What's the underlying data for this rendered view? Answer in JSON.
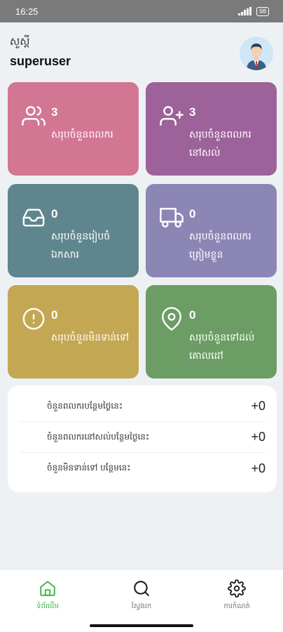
{
  "status_bar": {
    "time": "16:25",
    "battery": "98"
  },
  "header": {
    "greeting": "សួស្តី",
    "username": "superuser"
  },
  "cards": [
    {
      "id": "received",
      "count": "3",
      "label": "សរុបចំនួនពលករ",
      "color": "#d27693",
      "icon": "users-icon"
    },
    {
      "id": "remaining",
      "count": "3",
      "label": "សរុបចំនួនពលករ នៅសល់",
      "color": "#9d6299",
      "icon": "user-plus-icon"
    },
    {
      "id": "documents",
      "count": "0",
      "label": "សរុបចំនួនរៀបចំ ឯកសារ",
      "color": "#5f868e",
      "icon": "inbox-icon"
    },
    {
      "id": "prepare",
      "count": "0",
      "label": "សរុបចំនួនពលករ ត្រៀមខ្លួន",
      "color": "#8c86b5",
      "icon": "truck-icon"
    },
    {
      "id": "not-sent",
      "count": "0",
      "label": "សរុបចំនួនមិនទាន់ទៅ",
      "color": "#c3a752",
      "icon": "alert-circle-icon"
    },
    {
      "id": "arrived",
      "count": "0",
      "label": "សរុបចំនួនទៅដល់ គោលដៅ",
      "color": "#6b9d64",
      "icon": "map-pin-icon"
    }
  ],
  "stats": [
    {
      "label": "ចំនួនពលករបន្ថែមថ្ងៃនេះ",
      "value": "+0"
    },
    {
      "label": "ចំនួនពលករនៅសល់បន្ថែមថ្ងៃនេះ",
      "value": "+0"
    },
    {
      "label": "ចំនួនមិនទាន់ទៅ បន្ថែមនេះ",
      "value": "+0"
    }
  ],
  "nav": [
    {
      "label": "ទំព័រដើម",
      "icon": "home-icon",
      "active": true
    },
    {
      "label": "ស្វែងរក",
      "icon": "search-icon",
      "active": false
    },
    {
      "label": "ការកំណត់",
      "icon": "settings-icon",
      "active": false
    }
  ],
  "colors": {
    "accent": "#43b549",
    "background": "#eef1f4"
  }
}
